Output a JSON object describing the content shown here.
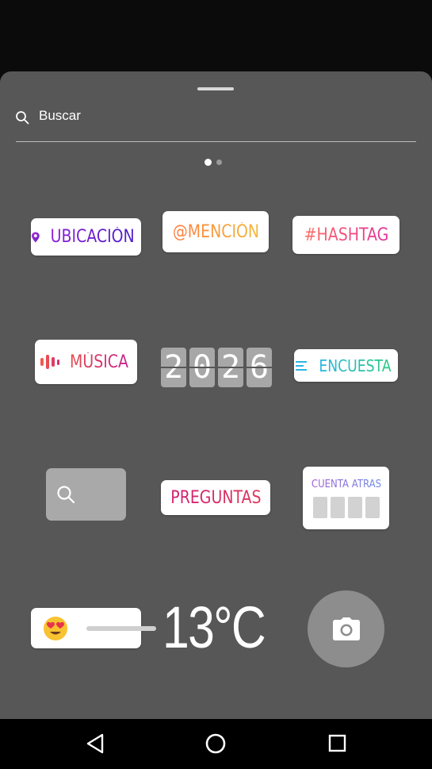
{
  "search": {
    "placeholder": "Buscar"
  },
  "pager": {
    "pages": 2,
    "active": 0
  },
  "stickers": {
    "location": "UBICACIÓN",
    "mention": "@MENCIÓN",
    "hashtag": "#HASHTAG",
    "music": "MÚSICA",
    "year_digits": [
      "2",
      "0",
      "2",
      "6"
    ],
    "poll": "ENCUESTA",
    "questions": "PREGUNTAS",
    "countdown": "CUENTA ATRÁS",
    "temperature": "13°C"
  },
  "icons": {
    "search": "search-icon",
    "location": "location-pin-icon",
    "music": "music-bars-icon",
    "poll": "poll-lines-icon",
    "emoji": "heart-eyes-emoji-icon",
    "camera": "camera-icon",
    "nav_back": "back-triangle-icon",
    "nav_home": "home-circle-icon",
    "nav_recents": "recents-square-icon"
  }
}
